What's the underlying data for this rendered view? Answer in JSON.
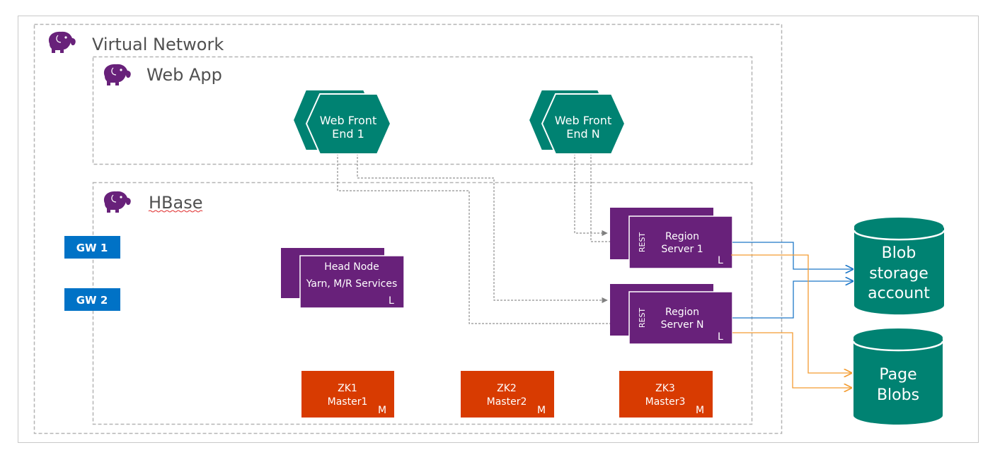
{
  "zones": {
    "virtual_network": "Virtual Network",
    "web_app": "Web App",
    "hbase": "HBase"
  },
  "web_front_ends": [
    {
      "line1": "Web Front",
      "line2": "End 1"
    },
    {
      "line1": "Web Front",
      "line2": "End N"
    }
  ],
  "gateways": [
    "GW 1",
    "GW 2"
  ],
  "head_node": {
    "line1": "Head Node",
    "line2": "Yarn, M/R Services",
    "tag": "L"
  },
  "region_servers": [
    {
      "side": "REST",
      "line1": "Region",
      "line2": "Server 1",
      "tag": "L"
    },
    {
      "side": "REST",
      "line1": "Region",
      "line2": "Server N",
      "tag": "L"
    }
  ],
  "zookeepers": [
    {
      "line1": "ZK1",
      "line2": "Master1",
      "tag": "M"
    },
    {
      "line1": "ZK2",
      "line2": "Master2",
      "tag": "M"
    },
    {
      "line1": "ZK3",
      "line2": "Master3",
      "tag": "M"
    }
  ],
  "storage": [
    {
      "line1": "Blob",
      "line2": "storage",
      "line3": "account"
    },
    {
      "line1": "Page",
      "line2": "Blobs"
    }
  ],
  "colors": {
    "purple": "#68217a",
    "teal": "#008272",
    "orange_box": "#d83b01",
    "gateway_blue": "#0072c6",
    "blob_link": "#1e78c8",
    "page_link": "#f39c32",
    "dashed_border": "#b4b4b4"
  },
  "icons": {
    "zone_icon": "hdinsight-elephant-icon"
  }
}
